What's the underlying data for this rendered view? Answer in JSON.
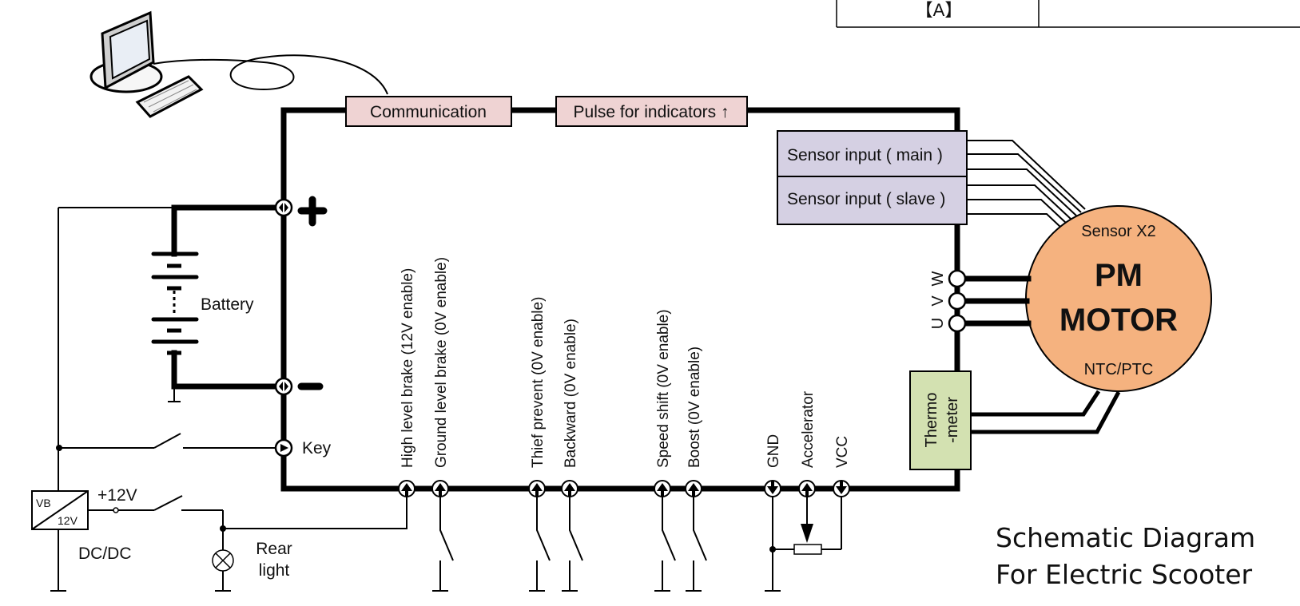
{
  "header_table": {
    "cell_left": "【A】",
    "cell_right": ""
  },
  "colors": {
    "module_pink": "#efd3d3",
    "sensor_lavender": "#d5d0e3",
    "motor_orange": "#f5b27f",
    "thermo_green": "#d3e1b1",
    "wire": "#000000"
  },
  "top_modules": {
    "communication": "Communication",
    "pulse": "Pulse for indicators ↑"
  },
  "sensor_modules": {
    "main": "Sensor input ( main )",
    "slave": "Sensor input ( slave )"
  },
  "motor": {
    "sensor_label": "Sensor X2",
    "line1": "PM",
    "line2": "MOTOR",
    "ntc_label": "NTC/PTC"
  },
  "phases": [
    "W",
    "V",
    "U"
  ],
  "thermometer": {
    "line1": "Thermo",
    "line2": "-meter"
  },
  "battery": {
    "label": "Battery",
    "plus": "+",
    "minus": "−"
  },
  "key_label": "Key",
  "dcdc": {
    "vb": "VB",
    "v12": "12V",
    "output": "+12V",
    "label": "DC/DC"
  },
  "rear_light": {
    "line1": "Rear",
    "line2": "light"
  },
  "inputs": [
    {
      "label": "High level brake (12V enable)"
    },
    {
      "label": "Ground level brake (0V enable)"
    },
    {
      "label": "Thief prevent (0V enable)"
    },
    {
      "label": "Backward (0V enable)"
    },
    {
      "label": "Speed shift (0V enable)"
    },
    {
      "label": "Boost (0V enable)"
    },
    {
      "label": "GND"
    },
    {
      "label": "Accelerator"
    },
    {
      "label": "VCC"
    }
  ],
  "caption": {
    "line1": "Schematic Diagram",
    "line2": "For Electric Scooter"
  }
}
